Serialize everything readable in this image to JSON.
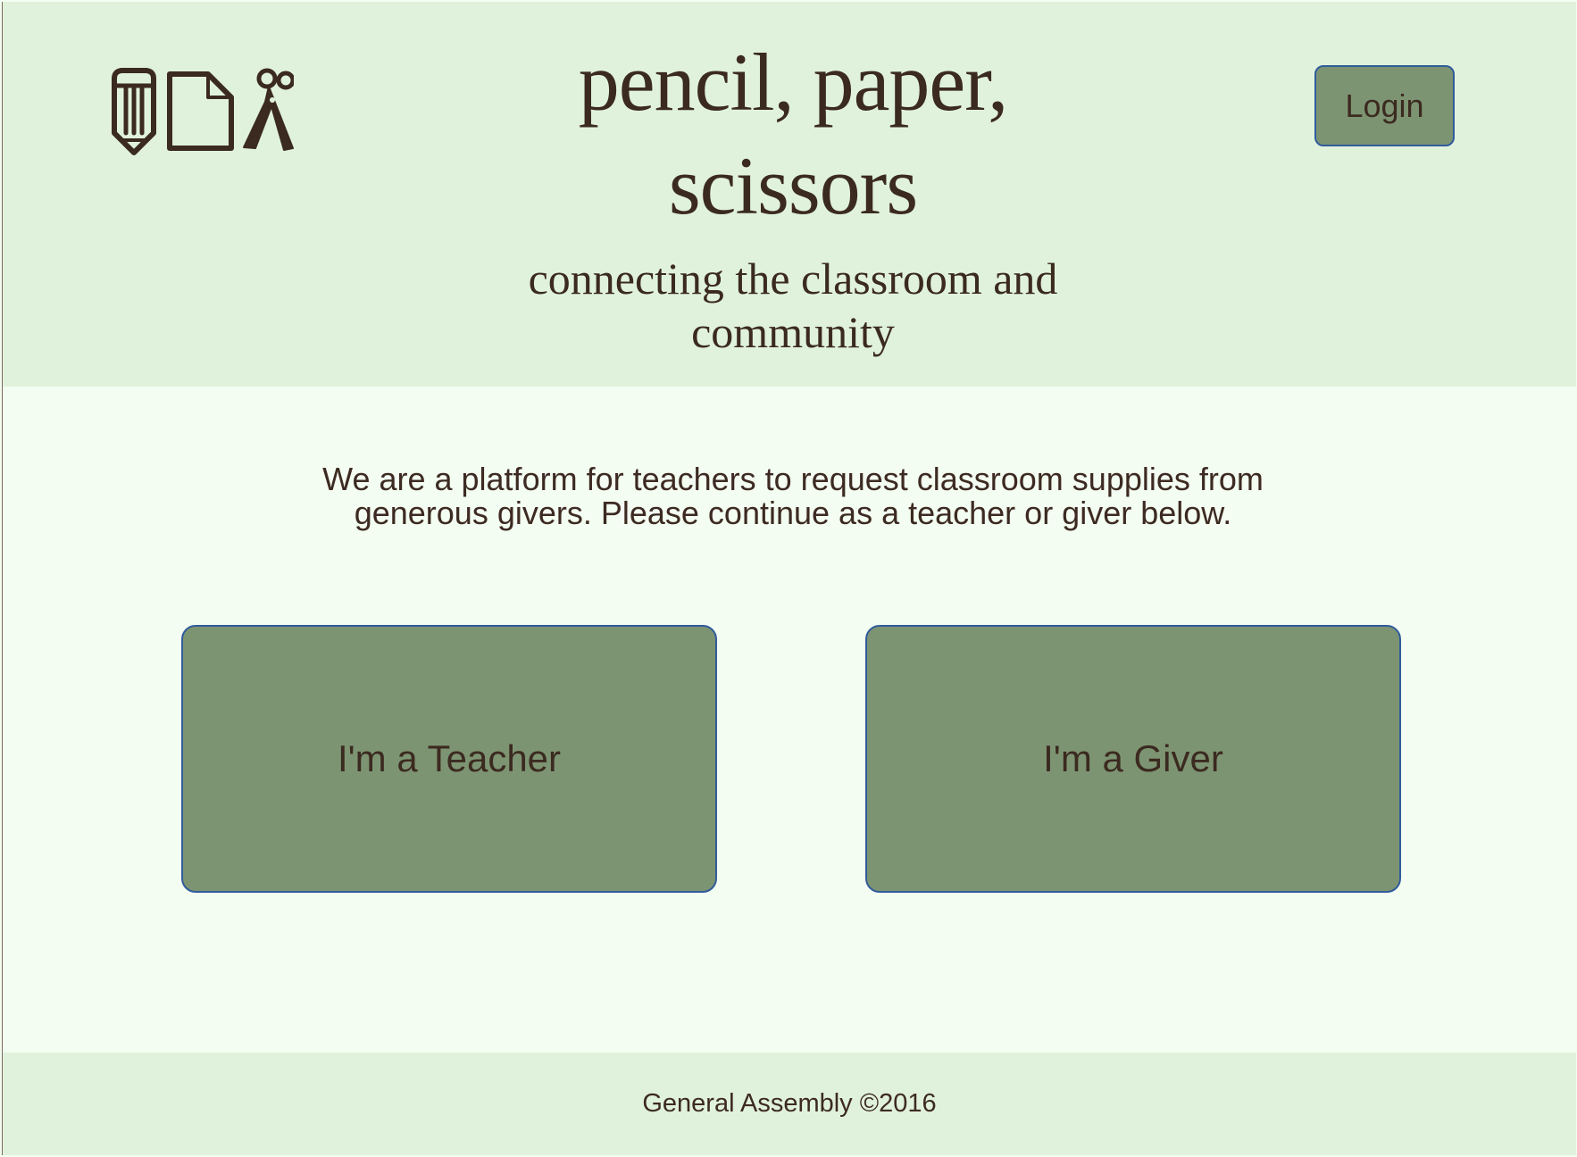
{
  "header": {
    "logo_icons": [
      "pencil-icon",
      "paper-icon",
      "scissors-icon"
    ],
    "title_line1": "pencil, paper,",
    "title_line2": "scissors",
    "tagline_line1": "connecting the classroom and",
    "tagline_line2": "community",
    "login_label": "Login"
  },
  "main": {
    "intro_line1": "We are a platform for teachers to request classroom supplies from",
    "intro_line2": "generous givers. Please continue as a teacher or giver below.",
    "teacher_label": "I'm a Teacher",
    "giver_label": "I'm a Giver"
  },
  "footer": {
    "copyright": "General Assembly ©2016"
  },
  "colors": {
    "header_background": "#e0f2db",
    "page_background": "#f3fdf1",
    "button_background": "#7d9472",
    "button_border": "#315c9c",
    "text": "#3b2a20"
  }
}
